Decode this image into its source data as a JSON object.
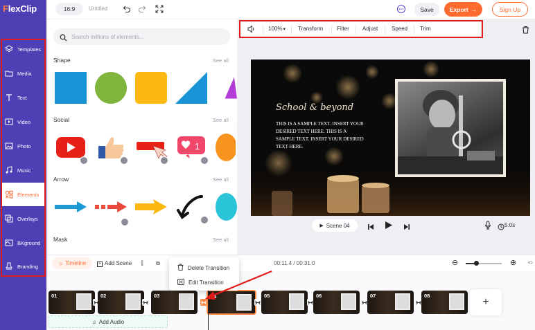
{
  "app": {
    "logo_prefix": "F",
    "logo_rest": "lexClip"
  },
  "sidebar": {
    "items": [
      {
        "label": "Templates",
        "icon": "layers-icon"
      },
      {
        "label": "Media",
        "icon": "folder-icon"
      },
      {
        "label": "Text",
        "icon": "text-icon"
      },
      {
        "label": "Video",
        "icon": "video-icon"
      },
      {
        "label": "Photo",
        "icon": "photo-icon"
      },
      {
        "label": "Music",
        "icon": "music-icon"
      },
      {
        "label": "Elements",
        "icon": "elements-icon",
        "active": true
      },
      {
        "label": "Overlays",
        "icon": "overlays-icon"
      },
      {
        "label": "BKground",
        "icon": "background-icon"
      },
      {
        "label": "Branding",
        "icon": "branding-icon"
      }
    ]
  },
  "topbar": {
    "ratio": "16:9",
    "project_name": "Untitled",
    "save_label": "Save",
    "export_label": "Export",
    "signup_label": "Sign Up"
  },
  "elements_panel": {
    "search_placeholder": "Search millions of elements...",
    "see_all": "See all",
    "sections": [
      {
        "title": "Shape"
      },
      {
        "title": "Social"
      },
      {
        "title": "Arrow"
      },
      {
        "title": "Mask"
      }
    ]
  },
  "edit_toolbar": {
    "volume_icon": "speaker-icon",
    "zoom": "100%",
    "items": [
      "Transform",
      "Filter",
      "Adjust",
      "Speed",
      "Trim"
    ]
  },
  "canvas": {
    "title": "School & beyond",
    "body": "THIS IS A SAMPLE TEXT. INSERT YOUR DESIRED TEXT HERE. THIS IS A SAMPLE TEXT. INSERT YOUR DESIRED TEXT HERE."
  },
  "playback": {
    "scene_label": "Scene 04",
    "duration": "5.0s"
  },
  "timeline": {
    "tab_label": "Timeline",
    "add_scene_label": "Add Scene",
    "time_display": "00:11.4 / 00:31.0",
    "zoom_level": 0.3,
    "clips": [
      "01",
      "02",
      "03",
      "04",
      "05",
      "06",
      "07",
      "08"
    ],
    "selected_clip": "04",
    "add_audio_label": "Add Audio"
  },
  "context_menu": {
    "items": [
      "Delete Transition",
      "Edit Transition"
    ]
  },
  "colors": {
    "sidebar": "#4f3fb5",
    "accent": "#ff6a2f",
    "highlight_box": "#e01b1b"
  }
}
